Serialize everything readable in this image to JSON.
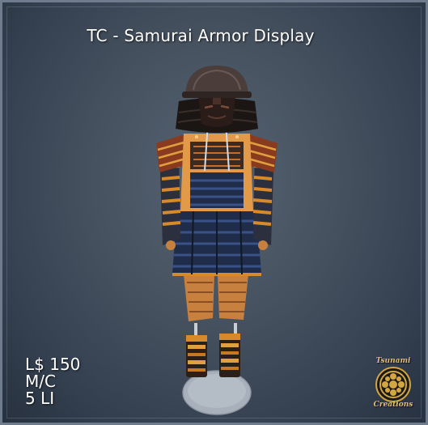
{
  "title": "TC - Samurai Armor Display",
  "price": "L$ 150",
  "permissions": "M/C",
  "land_impact": "5 LI",
  "logo": {
    "top_text": "Tsunami",
    "bottom_text": "Creations"
  },
  "image": {
    "subject": "samurai-armor-on-display-stand"
  },
  "colors": {
    "background": "#46525f",
    "frame_border": "#6e7c8d",
    "text": "#ffffff",
    "logo_gold": "#d4a640"
  }
}
